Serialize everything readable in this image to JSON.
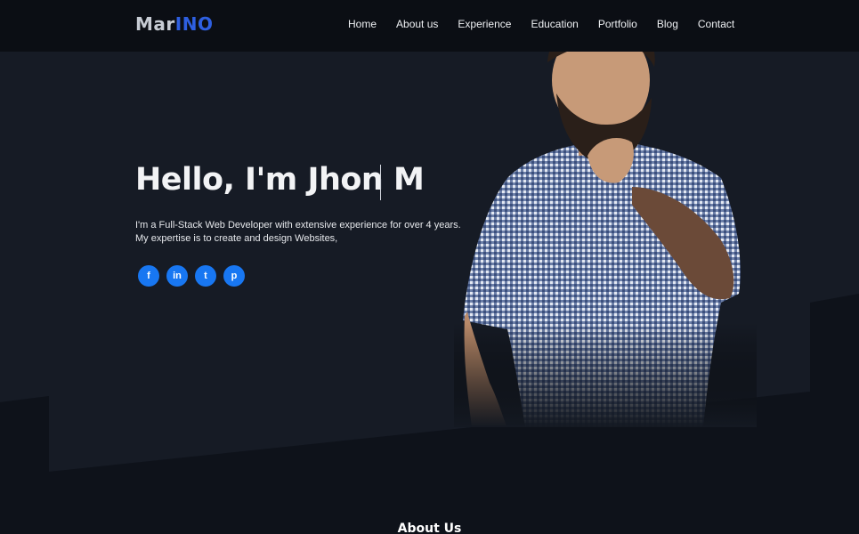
{
  "brand": {
    "logo_part1": "Mar",
    "logo_part2": "INO"
  },
  "nav": {
    "items": [
      {
        "label": "Home"
      },
      {
        "label": "About us"
      },
      {
        "label": "Experience"
      },
      {
        "label": "Education"
      },
      {
        "label": "Portfolio"
      },
      {
        "label": "Blog"
      },
      {
        "label": "Contact"
      }
    ]
  },
  "hero": {
    "title": "Hello, I'm Jhon M",
    "description": "I'm a Full-Stack Web Developer with extensive experience for over 4 years. My expertise is to create and design Websites,",
    "socials": [
      {
        "icon": "facebook-icon",
        "glyph": "f"
      },
      {
        "icon": "linkedin-icon",
        "glyph": "in"
      },
      {
        "icon": "twitter-icon",
        "glyph": "t"
      },
      {
        "icon": "pinterest-icon",
        "glyph": "p"
      }
    ]
  },
  "about": {
    "title": "About Us"
  },
  "colors": {
    "accent": "#1877f2",
    "logo_blue": "#2e5fe0",
    "bg_dark": "#0e121a",
    "hero_bg": "#141922"
  }
}
